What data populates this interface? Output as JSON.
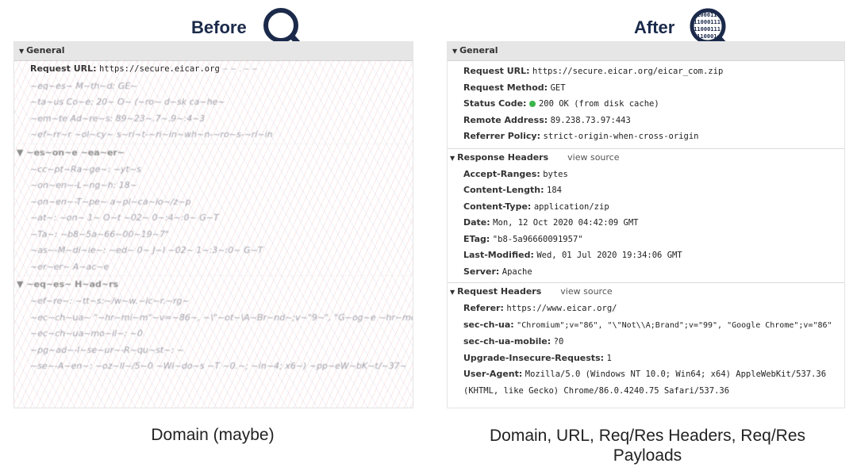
{
  "before": {
    "heading": "Before",
    "caption": "Domain (maybe)",
    "general_label": "General",
    "request_url_label": "Request URL:",
    "request_url_value": "https://secure.eicar.org"
  },
  "after": {
    "heading": "After",
    "caption": "Domain, URL, Req/Res Headers, Req/Res Payloads",
    "magnifier_binary": [
      "0100011",
      "011000111",
      "011000111",
      "0110001"
    ],
    "general": {
      "label": "General",
      "rows": [
        {
          "k": "Request URL:",
          "v": "https://secure.eicar.org/eicar_com.zip"
        },
        {
          "k": "Request Method:",
          "v": "GET"
        },
        {
          "k": "Status Code:",
          "v": "200 OK (from disk cache)"
        },
        {
          "k": "Remote Address:",
          "v": "89.238.73.97:443"
        },
        {
          "k": "Referrer Policy:",
          "v": "strict-origin-when-cross-origin"
        }
      ]
    },
    "response": {
      "label": "Response Headers",
      "view_source": "view source",
      "rows": [
        {
          "k": "Accept-Ranges:",
          "v": "bytes"
        },
        {
          "k": "Content-Length:",
          "v": "184"
        },
        {
          "k": "Content-Type:",
          "v": "application/zip"
        },
        {
          "k": "Date:",
          "v": "Mon, 12 Oct 2020 04:42:09 GMT"
        },
        {
          "k": "ETag:",
          "v": "\"b8-5a96660091957\""
        },
        {
          "k": "Last-Modified:",
          "v": "Wed, 01 Jul 2020 19:34:06 GMT"
        },
        {
          "k": "Server:",
          "v": "Apache"
        }
      ]
    },
    "request": {
      "label": "Request Headers",
      "view_source": "view source",
      "rows": [
        {
          "k": "Referer:",
          "v": "https://www.eicar.org/"
        },
        {
          "k": "sec-ch-ua:",
          "v": "\"Chromium\";v=\"86\", \"\\\"Not\\\\A;Brand\";v=\"99\", \"Google Chrome\";v=\"86\""
        },
        {
          "k": "sec-ch-ua-mobile:",
          "v": "?0"
        },
        {
          "k": "Upgrade-Insecure-Requests:",
          "v": "1"
        },
        {
          "k": "User-Agent:",
          "v": "Mozilla/5.0 (Windows NT 10.0; Win64; x64) AppleWebKit/537.36 (KHTML, like Gecko) Chrome/86.0.4240.75 Safari/537.36"
        }
      ]
    }
  },
  "colors": {
    "heading": "#1b2a4a",
    "status_dot": "#3bb54a",
    "section_bg": "#e6e6e6"
  }
}
